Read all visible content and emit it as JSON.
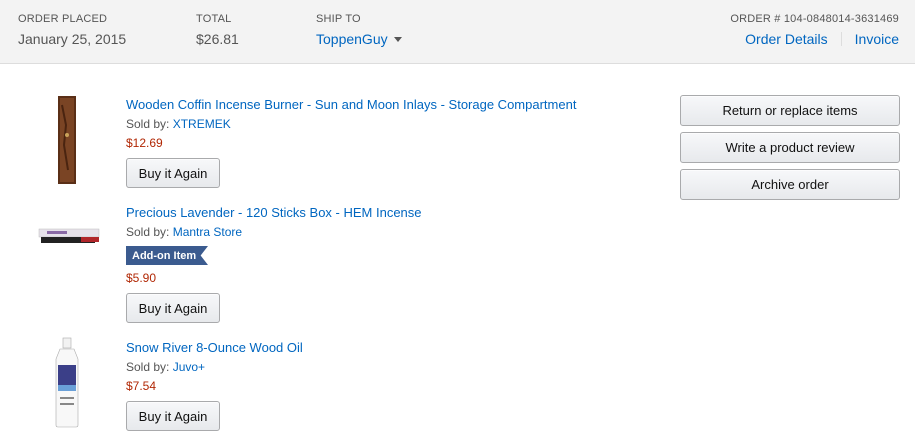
{
  "header": {
    "order_placed_label": "ORDER PLACED",
    "order_placed_value": "January 25, 2015",
    "total_label": "TOTAL",
    "total_value": "$26.81",
    "ship_to_label": "SHIP TO",
    "ship_to_value": "ToppenGuy",
    "order_number": "ORDER # 104-0848014-3631469",
    "order_details_link": "Order Details",
    "invoice_link": "Invoice"
  },
  "items": [
    {
      "title": "Wooden Coffin Incense Burner - Sun and Moon Inlays - Storage Compartment",
      "sold_by_label": "Sold by:",
      "seller": "XTREMEK",
      "price": "$12.69",
      "buy_again": "Buy it Again"
    },
    {
      "title": "Precious Lavender - 120 Sticks Box - HEM Incense",
      "sold_by_label": "Sold by:",
      "seller": "Mantra Store",
      "badge": "Add-on Item",
      "price": "$5.90",
      "buy_again": "Buy it Again"
    },
    {
      "title": "Snow River 8-Ounce Wood Oil",
      "sold_by_label": "Sold by:",
      "seller": "Juvo+",
      "price": "$7.54",
      "buy_again": "Buy it Again"
    }
  ],
  "actions": {
    "return_replace": "Return or replace items",
    "write_review": "Write a product review",
    "archive": "Archive order"
  },
  "colors": {
    "link": "#0066c0",
    "price": "#b12704",
    "badge": "#3b5b8f",
    "header_bg": "#f3f3f3"
  }
}
